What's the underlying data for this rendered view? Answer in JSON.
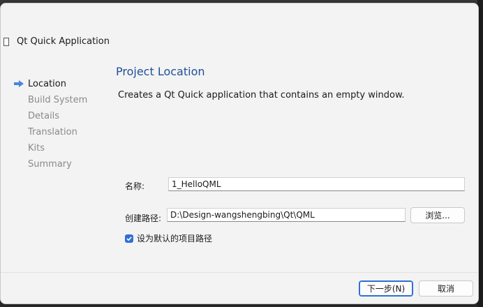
{
  "window": {
    "title": "Qt Quick Application"
  },
  "steps": [
    {
      "label": "Location",
      "active": true
    },
    {
      "label": "Build System",
      "active": false
    },
    {
      "label": "Details",
      "active": false
    },
    {
      "label": "Translation",
      "active": false
    },
    {
      "label": "Kits",
      "active": false
    },
    {
      "label": "Summary",
      "active": false
    }
  ],
  "page": {
    "title": "Project Location",
    "description": "Creates a Qt Quick application that contains an empty window."
  },
  "form": {
    "name_label": "名称:",
    "name_value": "1_HelloQML",
    "path_label": "创建路径:",
    "path_value": "D:\\Design-wangshengbing\\Qt\\QML",
    "browse_label": "浏览...",
    "default_path_label": "设为默认的项目路径",
    "default_path_checked": true
  },
  "footer": {
    "next_label": "下一步(N)",
    "cancel_label": "取消"
  },
  "colors": {
    "accent": "#2f6fd6",
    "title_blue": "#1f4e99",
    "step_arrow": "#4a86d8"
  },
  "icons": {
    "step_arrow": "arrow-right-icon",
    "checkbox": "checkmark-icon"
  }
}
